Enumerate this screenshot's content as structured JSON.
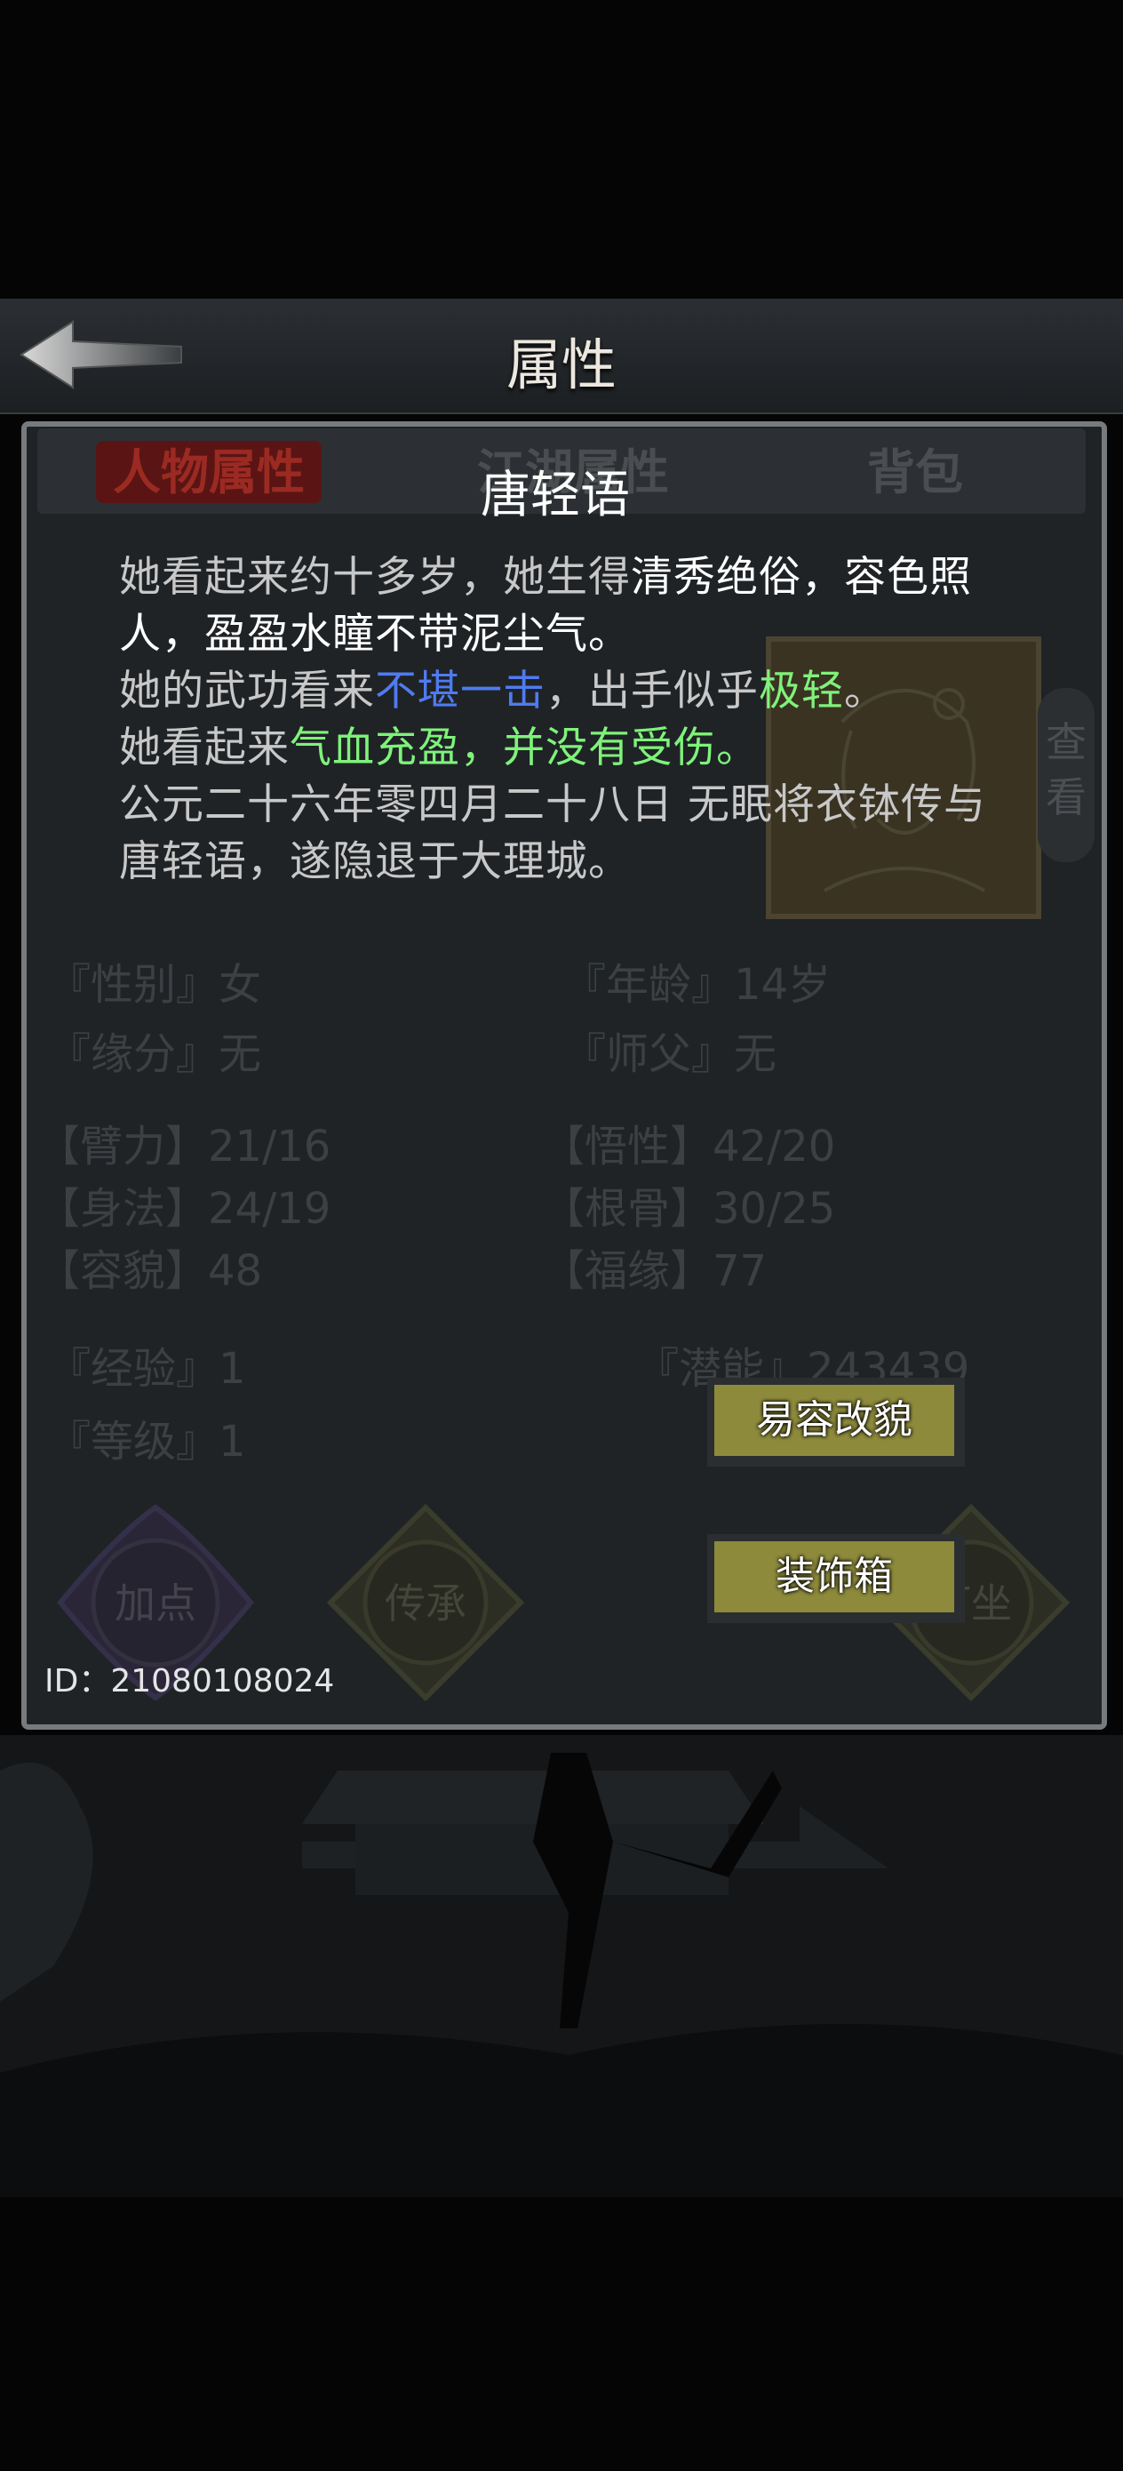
{
  "header": {
    "title": "属性",
    "back_icon": "back-arrow-icon"
  },
  "tabs": [
    {
      "label": "人物属性",
      "active": true
    },
    {
      "label": "江湖属性"
    },
    {
      "label": "背包"
    }
  ],
  "background_panel": {
    "view_button": "查看",
    "info_rows": [
      {
        "label": "『性别』",
        "value": "女"
      },
      {
        "label": "『年龄』",
        "value": "14岁"
      },
      {
        "label": "『缘分』",
        "value": "无"
      },
      {
        "label": "『师父』",
        "value": "无"
      }
    ],
    "attributes": [
      {
        "label": "【臂力】",
        "value": "21/16"
      },
      {
        "label": "【悟性】",
        "value": "42/20"
      },
      {
        "label": "【身法】",
        "value": "24/19"
      },
      {
        "label": "【根骨】",
        "value": "30/25"
      },
      {
        "label": "【容貌】",
        "value": "48"
      },
      {
        "label": "【福缘】",
        "value": "77"
      }
    ],
    "experience": {
      "label": "『经验』",
      "value": "1"
    },
    "potential": {
      "label": "『潜能』",
      "value": "243439"
    },
    "level": {
      "label": "『等级』",
      "value": "1"
    },
    "round_buttons": [
      "加点",
      "传承",
      "打坐"
    ]
  },
  "overlay": {
    "name": "唐轻语",
    "desc": {
      "l1_a": "她看起来约十多岁，她生得",
      "l1_b": "清秀绝俗，容色照人，盈盈水瞳不带泥尘气。",
      "l2_a": "她的武功看来",
      "l2_b": "不堪一击",
      "l2_c": "，出手似乎",
      "l2_d": "极轻",
      "l2_e": "。",
      "l3_a": "她看起来",
      "l3_b": "气血充盈，并没有受伤。",
      "l4": "公元二十六年零四月二十八日 无眠将衣钵传与唐轻语，遂隐退于大理城。"
    },
    "buttons": {
      "disguise": "易容改貌",
      "decoration": "装饰箱"
    },
    "id_text": "ID：21080108024"
  },
  "colors": {
    "blue_text": "#4f7bf0",
    "green_text": "#7ff27a",
    "button_face": "#8d8a3c",
    "panel_border": "#777b7e"
  }
}
